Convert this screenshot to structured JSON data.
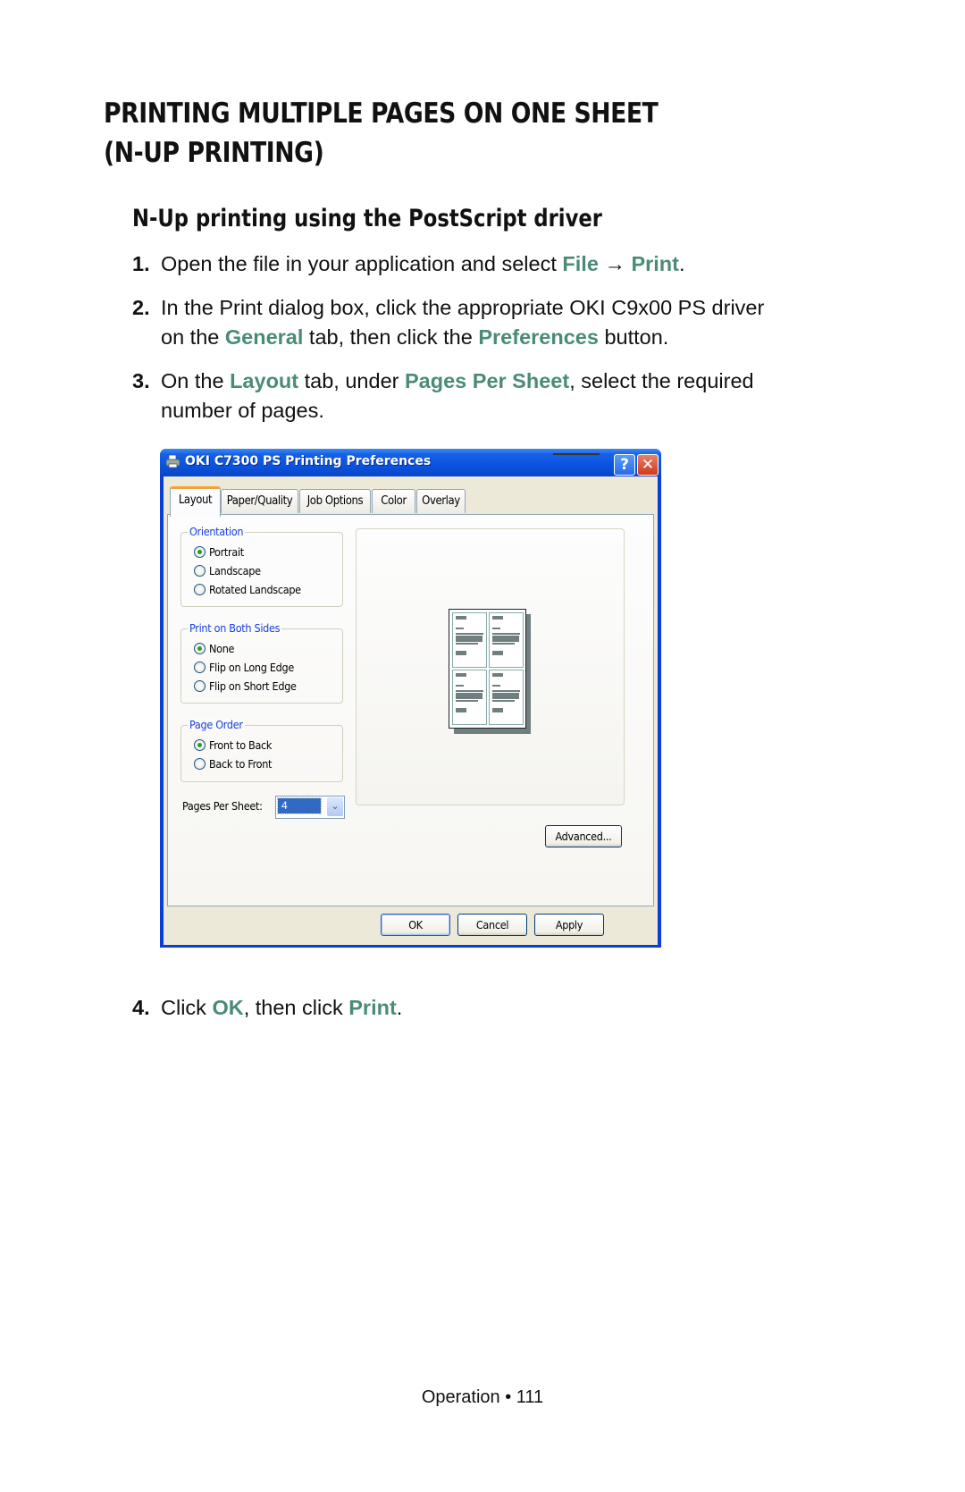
{
  "document": {
    "heading": {
      "line1": "PRINTING MULTIPLE PAGES ON ONE SHEET",
      "line2": "(N-UP PRINTING)"
    },
    "subheading": "N-Up printing using the PostScript driver",
    "steps": [
      {
        "number": "1.",
        "parts": [
          "Open the file in your application and select ",
          "File",
          " → ",
          "Print",
          "."
        ]
      },
      {
        "number": "2.",
        "line1": "In the Print dialog box, click the appropriate OKI C9x00 PS driver",
        "line2_parts": [
          "on the ",
          "General",
          " tab, then click the ",
          "Preferences",
          " button."
        ]
      },
      {
        "number": "3.",
        "line1_parts": [
          "On the ",
          "Layout",
          " tab, under ",
          "Pages Per Sheet",
          ", select the required"
        ],
        "line2": "number of pages."
      },
      {
        "number": "4.",
        "parts": [
          "Click ",
          "OK",
          ", then click ",
          "Print",
          "."
        ]
      }
    ],
    "highlight_color": "#4a8b78",
    "footer": "Operation • 111"
  },
  "dialog": {
    "title": "OKI C7300 PS Printing Preferences",
    "title_icon": "printer-icon",
    "help_label": "?",
    "close_label": "✕",
    "tabs": [
      {
        "label": "Layout",
        "active": true
      },
      {
        "label": "Paper/Quality",
        "active": false
      },
      {
        "label": "Job Options",
        "active": false
      },
      {
        "label": "Color",
        "active": false
      },
      {
        "label": "Overlay",
        "active": false
      }
    ],
    "orientation": {
      "label": "Orientation",
      "options": [
        "Portrait",
        "Landscape",
        "Rotated Landscape"
      ],
      "selected": "Portrait"
    },
    "print_both_sides": {
      "label": "Print on Both Sides",
      "options": [
        "None",
        "Flip on Long Edge",
        "Flip on Short Edge"
      ],
      "selected": "None"
    },
    "page_order": {
      "label": "Page Order",
      "options": [
        "Front to Back",
        "Back to Front"
      ],
      "selected": "Front to Back"
    },
    "pages_per_sheet": {
      "label": "Pages Per Sheet:",
      "value": "4",
      "dropdown_icon": "chevron-down-icon"
    },
    "preview": {
      "pages_shown": 4
    },
    "buttons": {
      "advanced": "Advanced...",
      "ok": "OK",
      "cancel": "Cancel",
      "apply": "Apply"
    },
    "colors": {
      "titlebar": "#0a53e0",
      "group_label": "#1a3ee0",
      "dialog_bg": "#ece9d8",
      "active_tab_accent": "#f2a23a",
      "radio_dot": "#21a121",
      "combo_selected": "#316ac5"
    }
  }
}
